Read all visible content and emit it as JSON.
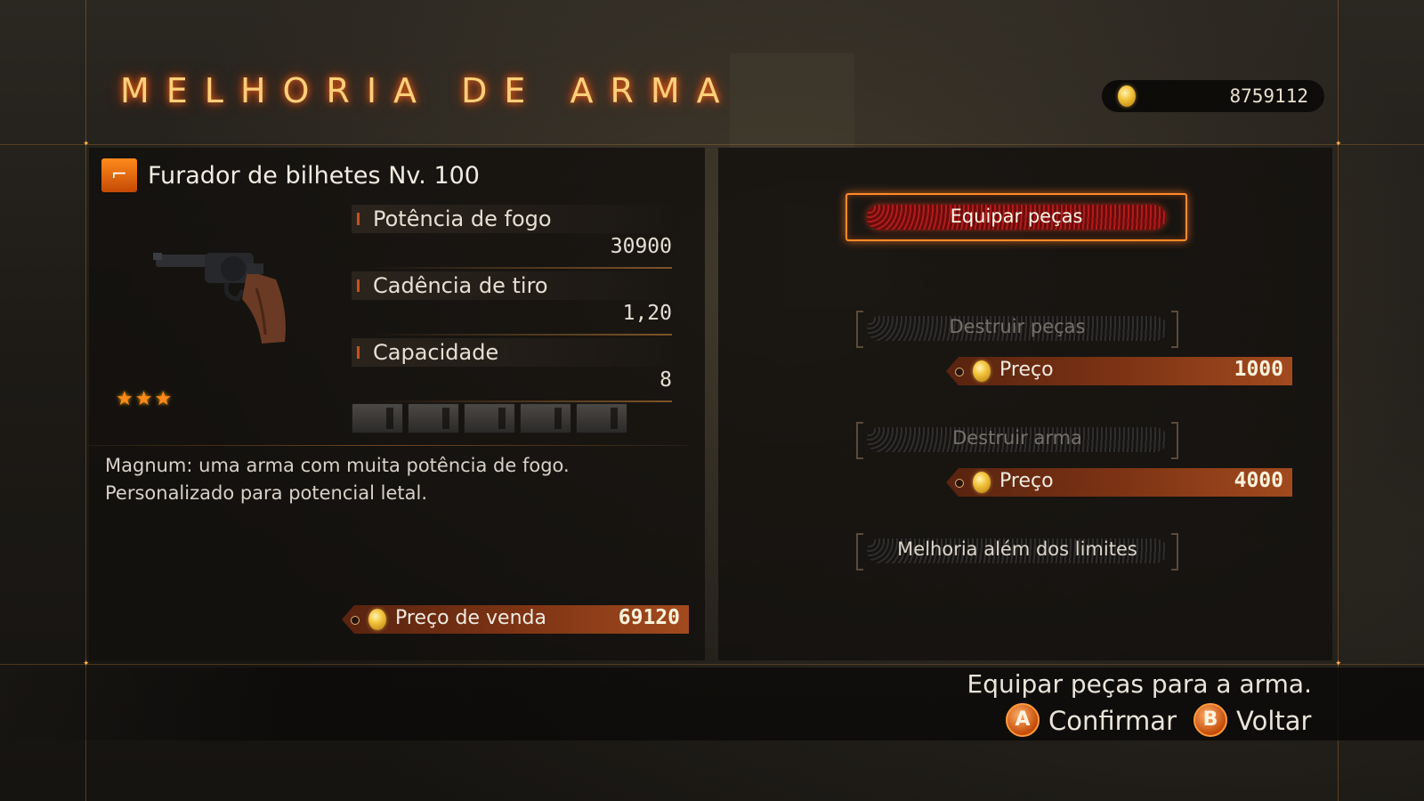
{
  "title": "MELHORIA DE ARMA",
  "money": {
    "amount": "8759112",
    "icon": "coin-icon"
  },
  "weapon": {
    "name": "Furador de bilhetes Nv. 100",
    "icon": "gun-icon",
    "stars": "★★★",
    "stats": [
      {
        "label": "Potência de fogo",
        "value": "30900"
      },
      {
        "label": "Cadência de tiro",
        "value": "1,20"
      },
      {
        "label": "Capacidade",
        "value": "8"
      }
    ],
    "slots_count": 5,
    "description": [
      "Magnum: uma arma com muita potência de fogo.",
      "Personalizado para potencial letal."
    ],
    "sell": {
      "label": "Preço de venda",
      "value": "69120"
    }
  },
  "menu": {
    "equip": "Equipar peças",
    "destroy_parts": "Destruir peças",
    "destroy_parts_price": {
      "label": "Preço",
      "value": "1000"
    },
    "destroy_weapon": "Destruir arma",
    "destroy_weapon_price": {
      "label": "Preço",
      "value": "4000"
    },
    "limit_break": "Melhoria além dos limites"
  },
  "hint": "Equipar peças para a arma.",
  "prompts": {
    "confirm_key": "A",
    "confirm_label": "Confirmar",
    "back_key": "B",
    "back_label": "Voltar"
  },
  "colors": {
    "accent": "#ff8a2a",
    "title_glow": "#ff6a1a",
    "tag": "#7e3414"
  }
}
